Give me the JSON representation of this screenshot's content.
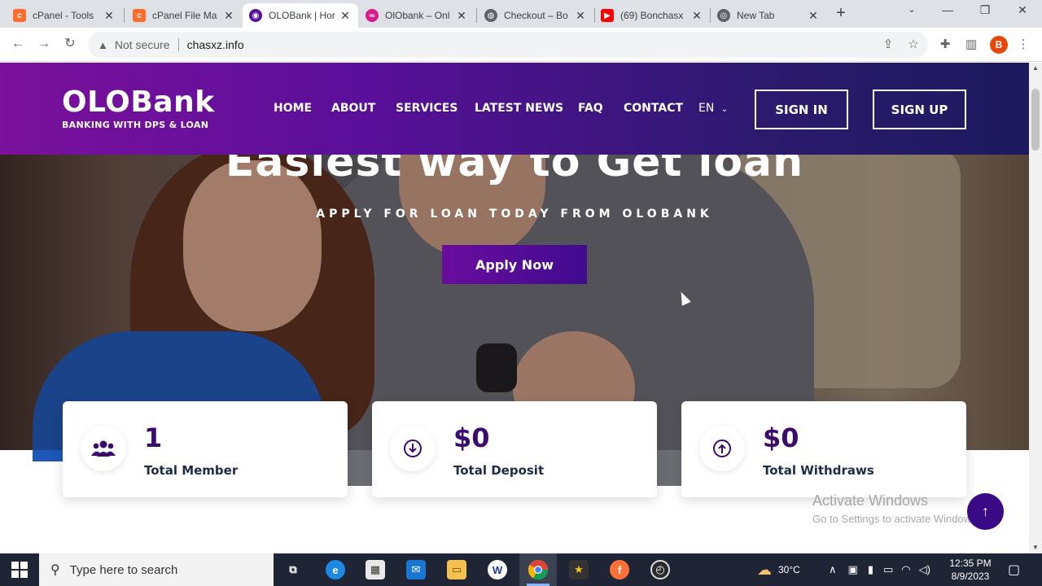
{
  "browser": {
    "tabs": [
      {
        "title": "cPanel - Tools",
        "favicon": "cpanel-icon",
        "color": "#ff6c2c"
      },
      {
        "title": "cPanel File Ma",
        "favicon": "cpanel-icon",
        "color": "#ff6c2c"
      },
      {
        "title": "OLOBank | Hor",
        "favicon": "olobank-icon",
        "color": "#5a0f9a"
      },
      {
        "title": "OlObank – Onl",
        "favicon": "link-icon",
        "color": "#d81b8c"
      },
      {
        "title": "Checkout – Bo",
        "favicon": "globe-icon",
        "color": "#5f6368"
      },
      {
        "title": "(69) Bonchasx",
        "favicon": "youtube-icon",
        "color": "#ff0000"
      },
      {
        "title": "New Tab",
        "favicon": "chrome-icon",
        "color": "#5f6368"
      }
    ],
    "security_label": "Not secure",
    "url": "chasxz.info",
    "profile_initial": "B"
  },
  "site": {
    "logo_name": "OLOBank",
    "logo_tagline": "BANKING WITH DPS & LOAN",
    "nav": [
      "HOME",
      "ABOUT",
      "SERVICES",
      "LATEST NEWS",
      "FAQ",
      "CONTACT"
    ],
    "language": "EN",
    "sign_in": "SIGN IN",
    "sign_up": "SIGN UP",
    "hero_title": "Easiest way to Get loan",
    "hero_subtitle": "APPLY FOR LOAN TODAY FROM OLOBANK",
    "apply_button": "Apply Now",
    "stats": [
      {
        "value": "1",
        "label": "Total Member",
        "icon": "users-icon"
      },
      {
        "value": "$0",
        "label": "Total Deposit",
        "icon": "arrow-down-circle-icon"
      },
      {
        "value": "$0",
        "label": "Total Withdraws",
        "icon": "arrow-up-circle-icon"
      }
    ]
  },
  "watermark": {
    "line1": "Activate Windows",
    "line2": "Go to Settings to activate Windows."
  },
  "taskbar": {
    "search_placeholder": "Type here to search",
    "temperature": "30°C",
    "time": "12:35 PM",
    "date": "8/9/2023"
  },
  "colors": {
    "brand_purple": "#5a0f9a",
    "brand_dark": "#3b0a6e",
    "header_gradient_end": "#1d1a5e"
  }
}
